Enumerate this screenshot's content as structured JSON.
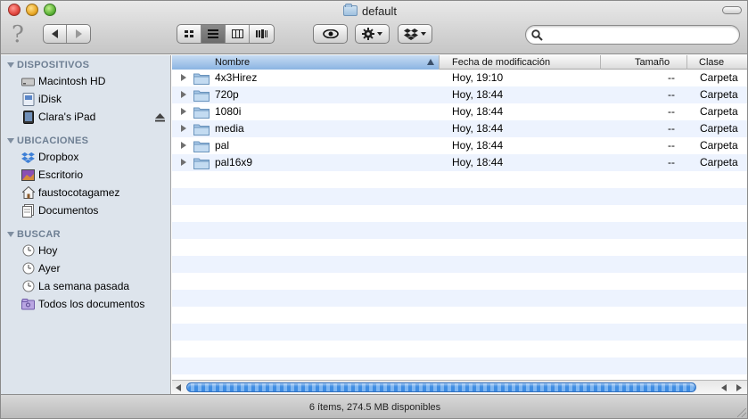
{
  "window": {
    "title": "default"
  },
  "toolbar": {
    "help_icon": "question-mark",
    "back_icon": "back-arrow",
    "forward_icon": "forward-arrow",
    "view_modes": [
      "icon-view",
      "list-view",
      "column-view",
      "coverflow-view"
    ],
    "active_view": "list-view",
    "quicklook_icon": "eye",
    "action_icon": "gear",
    "dropbox_icon": "dropbox",
    "search": {
      "value": "",
      "placeholder": ""
    }
  },
  "sidebar": {
    "sections": [
      {
        "title": "DISPOSITIVOS",
        "items": [
          {
            "label": "Macintosh HD",
            "icon": "hard-disk"
          },
          {
            "label": "iDisk",
            "icon": "idisk"
          },
          {
            "label": "Clara's iPad",
            "icon": "ipad"
          }
        ]
      },
      {
        "title": "UBICACIONES",
        "items": [
          {
            "label": "Dropbox",
            "icon": "dropbox"
          },
          {
            "label": "Escritorio",
            "icon": "desktop"
          },
          {
            "label": "faustocotagamez",
            "icon": "home"
          },
          {
            "label": "Documentos",
            "icon": "documents"
          }
        ]
      },
      {
        "title": "BUSCAR",
        "items": [
          {
            "label": "Hoy",
            "icon": "clock"
          },
          {
            "label": "Ayer",
            "icon": "clock"
          },
          {
            "label": "La semana pasada",
            "icon": "clock"
          },
          {
            "label": "Todos los documentos",
            "icon": "smart-folder"
          }
        ]
      }
    ]
  },
  "columns": {
    "name": "Nombre",
    "date": "Fecha de modificación",
    "size": "Tamaño",
    "kind": "Clase"
  },
  "files": [
    {
      "name": "4x3Hirez",
      "date": "Hoy, 19:10",
      "size": "--",
      "kind": "Carpeta"
    },
    {
      "name": "720p",
      "date": "Hoy, 18:44",
      "size": "--",
      "kind": "Carpeta"
    },
    {
      "name": "1080i",
      "date": "Hoy, 18:44",
      "size": "--",
      "kind": "Carpeta"
    },
    {
      "name": "media",
      "date": "Hoy, 18:44",
      "size": "--",
      "kind": "Carpeta"
    },
    {
      "name": "pal",
      "date": "Hoy, 18:44",
      "size": "--",
      "kind": "Carpeta"
    },
    {
      "name": "pal16x9",
      "date": "Hoy, 18:44",
      "size": "--",
      "kind": "Carpeta"
    }
  ],
  "status": {
    "text": "6 ítems, 274.5 MB disponibles"
  },
  "colors": {
    "sidebar_bg": "#dde4ec",
    "row_alt": "#edf3fe",
    "selection": "#3f8de3"
  }
}
